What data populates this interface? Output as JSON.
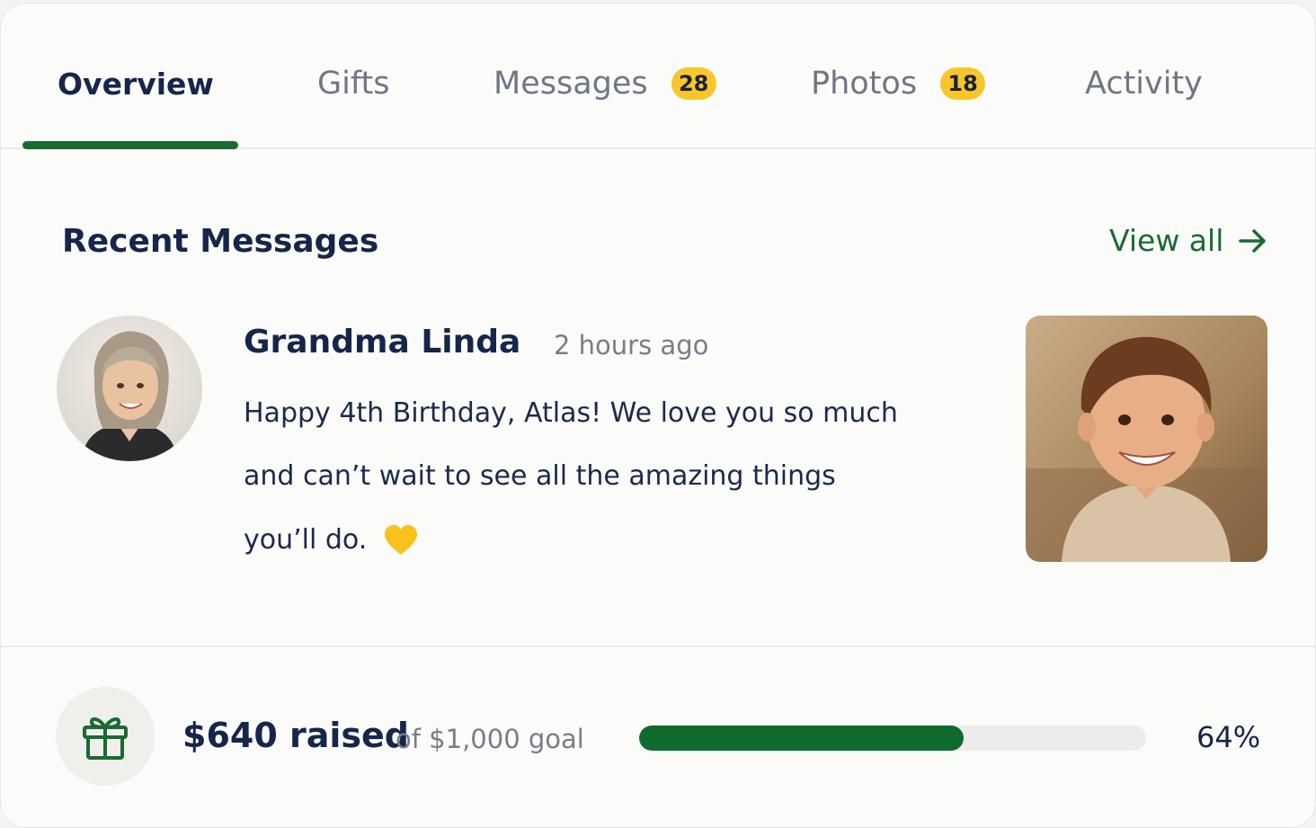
{
  "tabs": [
    {
      "label": "Overview",
      "badge": null,
      "active": true
    },
    {
      "label": "Gifts",
      "badge": null,
      "active": false
    },
    {
      "label": "Messages",
      "badge": "28",
      "active": false
    },
    {
      "label": "Photos",
      "badge": "18",
      "active": false
    },
    {
      "label": "Activity",
      "badge": null,
      "active": false
    }
  ],
  "section": {
    "title": "Recent Messages",
    "view_all": "View all"
  },
  "message": {
    "author": "Grandma Linda",
    "time": "2 hours ago",
    "lines": [
      "Happy 4th Birthday, Atlas! We love you so much",
      "and can’t wait to see all the amazing things",
      "you’ll do."
    ]
  },
  "fundraiser": {
    "raised": "$640 raised",
    "goal": "of $1,000 goal",
    "percent_label": "64%",
    "progress": 0.64
  },
  "colors": {
    "accent_green": "#1a6a33",
    "badge_yellow": "#f8c62a",
    "heart_yellow": "#f7c21c",
    "text_navy": "#16264a"
  },
  "icons": {
    "view_all": "arrow-right-icon",
    "emoji": "yellow-heart-icon",
    "fundraiser": "gift-icon"
  }
}
